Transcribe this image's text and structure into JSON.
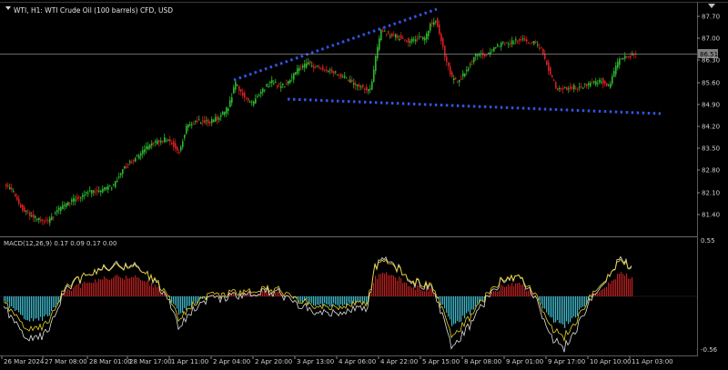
{
  "chart": {
    "symbol_title": "WTI, H1:  WTI Crude Oil (100 barrels) CFD, USD",
    "current_price": "86.51",
    "colors": {
      "background": "#000000",
      "bull": "#2eb82e",
      "bear": "#d42020",
      "trendline": "#3355e6",
      "grid": "#2a2a2a",
      "price_line": "#8c8c8c",
      "macd_line": "#e0e0e0",
      "signal_line": "#e8d020",
      "hist_pos": "#b52020",
      "hist_neg": "#3fb6c8"
    },
    "price_axis": [
      "87.70",
      "87.00",
      "86.30",
      "85.60",
      "84.90",
      "84.20",
      "83.50",
      "82.80",
      "82.10",
      "81.40"
    ],
    "macd": {
      "title": "MACD(12,26,9) 0.17 0.09 0.17 0.00",
      "axis": [
        "0.55",
        "-0.56"
      ]
    },
    "time_axis": [
      "26 Mar 2024",
      "27 Mar 08:00",
      "28 Mar 01:00",
      "28 Mar 17:00",
      "1 Apr 11:00",
      "2 Apr 04:00",
      "2 Apr 20:00",
      "3 Apr 13:00",
      "4 Apr 06:00",
      "4 Apr 22:00",
      "5 Apr 15:00",
      "8 Apr 08:00",
      "9 Apr 01:00",
      "9 Apr 17:00",
      "10 Apr 10:00",
      "11 Apr 03:00"
    ]
  }
}
